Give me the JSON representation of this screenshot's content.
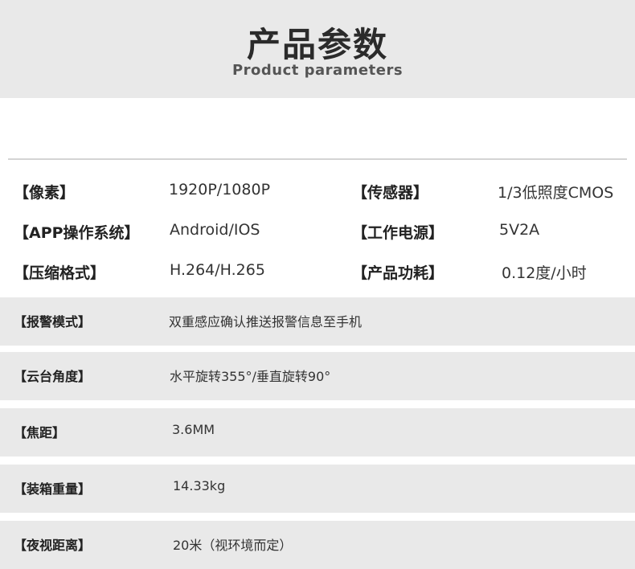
{
  "header": {
    "title": "产品参数",
    "subtitle": "Product parameters"
  },
  "pairs": [
    {
      "l1": "【像素】",
      "v1": "1920P/1080P",
      "l2": "【传感器】",
      "v2": "1/3低照度CMOS"
    },
    {
      "l1": "【APP操作系统】",
      "v1": "Android/IOS",
      "l2": "【工作电源】",
      "v2": "5V2A"
    },
    {
      "l1": "【压缩格式】",
      "v1": "H.264/H.265",
      "l2": "【产品功耗】",
      "v2": "0.12度/小时"
    }
  ],
  "bands": [
    {
      "label": "【报警模式】",
      "value": "双重感应确认推送报警信息至手机"
    },
    {
      "label": "【云台角度】",
      "value": "水平旋转355°/垂直旋转90°"
    },
    {
      "label": "【焦距】",
      "value": "3.6MM"
    },
    {
      "label": "【装箱重量】",
      "value": "14.33kg"
    },
    {
      "label": "【夜视距离】",
      "value": "20米（视环境而定）"
    }
  ]
}
